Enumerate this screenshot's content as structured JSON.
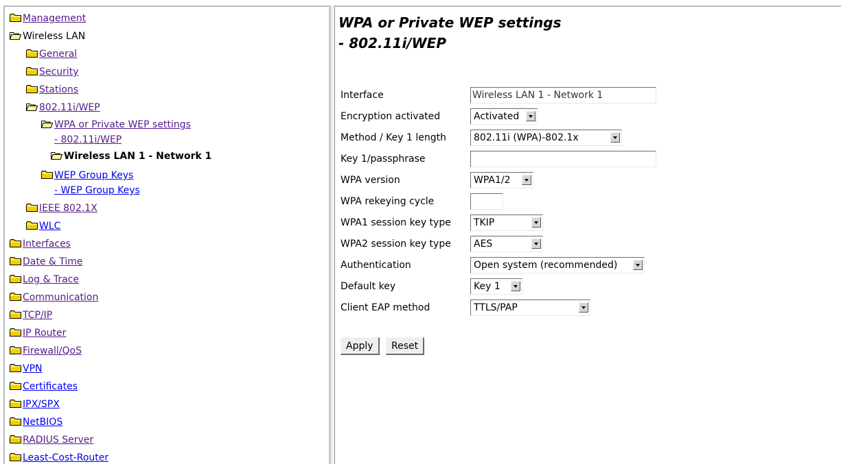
{
  "nav": {
    "management": "Management",
    "wireless_lan": "Wireless LAN",
    "general": "General",
    "security": "Security",
    "stations": "Stations",
    "wep_80211i": "802.11i/WEP",
    "wpa_settings_line1": "WPA or Private WEP settings",
    "wpa_settings_line2": "- 802.11i/WEP",
    "current_network": "Wireless LAN 1 - Network 1",
    "wep_group_keys_line1": "WEP Group Keys",
    "wep_group_keys_line2": "- WEP Group Keys",
    "ieee_8021x": "IEEE 802.1X",
    "wlc": "WLC",
    "interfaces": "Interfaces",
    "date_time": "Date & Time",
    "log_trace": "Log & Trace",
    "communication": "Communication",
    "tcpip": "TCP/IP",
    "ip_router": "IP Router",
    "firewall_qos": "Firewall/QoS",
    "vpn": "VPN",
    "certificates": "Certificates",
    "ipx_spx": "IPX/SPX",
    "netbios": "NetBIOS",
    "radius_server": "RADIUS Server",
    "least_cost_router": "Least-Cost-Router"
  },
  "page": {
    "title_line1": "WPA or Private WEP settings",
    "title_line2": "- 802.11i/WEP"
  },
  "form": {
    "interface": {
      "label": "Interface",
      "value": "Wireless LAN 1 - Network 1"
    },
    "encryption": {
      "label": "Encryption activated",
      "value": "Activated"
    },
    "method": {
      "label": "Method / Key 1 length",
      "value": "802.11i (WPA)-802.1x"
    },
    "passphrase": {
      "label": "Key 1/passphrase",
      "value": ""
    },
    "wpa_version": {
      "label": "WPA version",
      "value": "WPA1/2"
    },
    "rekeying": {
      "label": "WPA rekeying cycle",
      "value": ""
    },
    "wpa1_key_type": {
      "label": "WPA1 session key type",
      "value": "TKIP"
    },
    "wpa2_key_type": {
      "label": "WPA2 session key type",
      "value": "AES"
    },
    "authentication": {
      "label": "Authentication",
      "value": "Open system (recommended)"
    },
    "default_key": {
      "label": "Default key",
      "value": "Key 1"
    },
    "eap_method": {
      "label": "Client EAP method",
      "value": "TTLS/PAP"
    }
  },
  "buttons": {
    "apply": "Apply",
    "reset": "Reset"
  },
  "colors": {
    "link_visited": "#551a8b",
    "link_unvisited": "#0000ee",
    "folder": "#e8c200"
  }
}
